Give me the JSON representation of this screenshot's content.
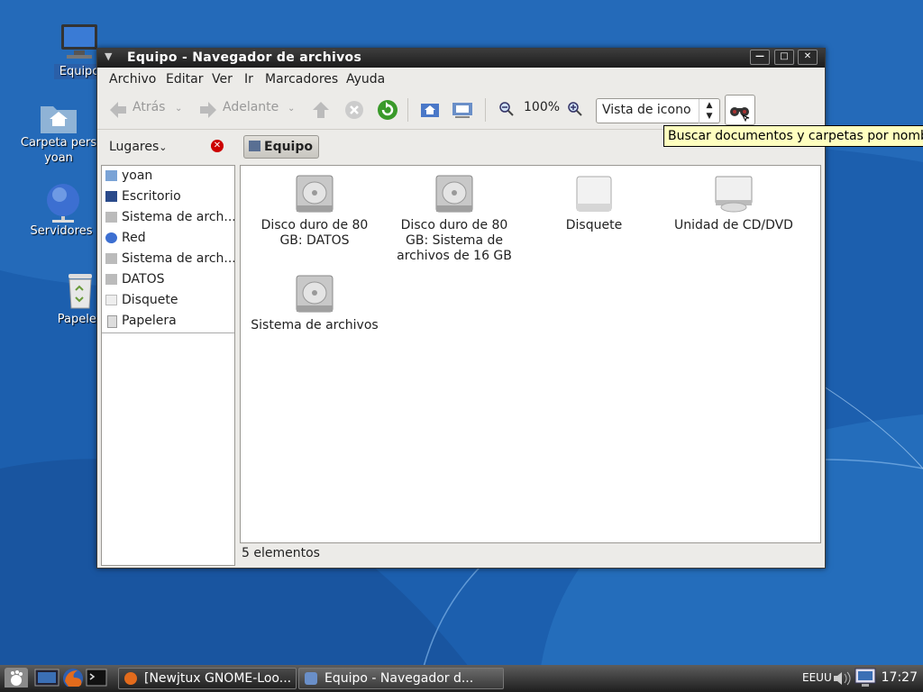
{
  "desktop": {
    "icons": [
      {
        "label": "Equipo",
        "icon": "computer-icon"
      },
      {
        "label1": "Carpeta pers",
        "label2": "yoan",
        "icon": "home-folder-icon"
      },
      {
        "label": "Servidores",
        "icon": "network-globe-icon"
      },
      {
        "label": "Papeler",
        "icon": "trash-icon"
      }
    ]
  },
  "window": {
    "title": "Equipo - Navegador de archivos",
    "menu": [
      "Archivo",
      "Editar",
      "Ver",
      "Ir",
      "Marcadores",
      "Ayuda"
    ],
    "toolbar": {
      "back_label": "Atrás",
      "forward_label": "Adelante",
      "zoom_level": "100%",
      "view_mode": "Vista de icono"
    },
    "tooltip": "Buscar documentos y carpetas por nombre",
    "places_label": "Lugares",
    "breadcrumb": "Equipo",
    "sidebar": [
      "yoan",
      "Escritorio",
      "Sistema de arch...",
      "Red",
      "Sistema de arch...",
      "DATOS",
      "Disquete",
      "Papelera"
    ],
    "files": [
      {
        "name_line1": "Disco duro de 80",
        "name_line2": "GB: DATOS",
        "name_line3": "",
        "icon": "hard-disk-icon"
      },
      {
        "name_line1": "Disco duro de 80",
        "name_line2": "GB: Sistema de",
        "name_line3": "archivos de 16 GB",
        "icon": "hard-disk-icon"
      },
      {
        "name_line1": "Disquete",
        "name_line2": "",
        "name_line3": "",
        "icon": "floppy-icon"
      },
      {
        "name_line1": "Unidad de CD/DVD",
        "name_line2": "",
        "name_line3": "",
        "icon": "optical-drive-icon"
      },
      {
        "name_line1": "Sistema de archivos",
        "name_line2": "",
        "name_line3": "",
        "icon": "hard-disk-icon"
      }
    ],
    "status": "5 elementos"
  },
  "taskbar": {
    "tasks": [
      "[Newjtux GNOME-Loo...",
      "Equipo - Navegador d..."
    ],
    "keyboard_layout": "EEUU",
    "clock": "17:27"
  }
}
